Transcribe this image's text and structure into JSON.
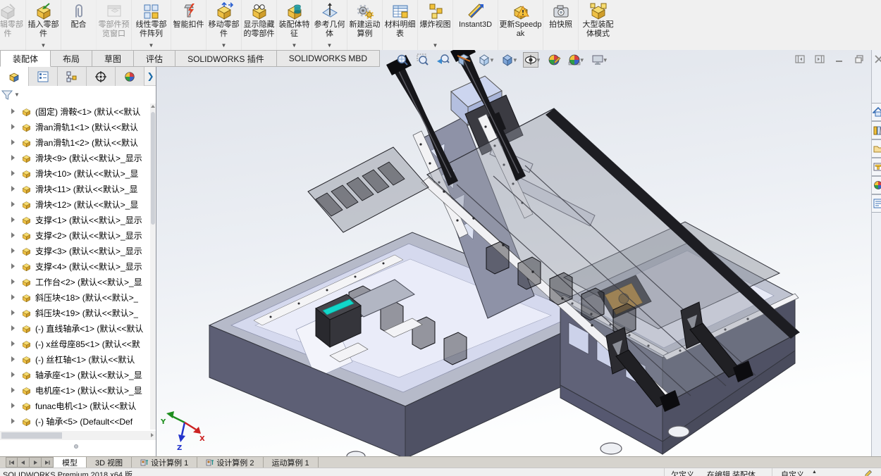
{
  "command_manager": {
    "buttons": [
      {
        "label": "编辑零部件",
        "icon": "edit-component-icon",
        "disabled": true,
        "dropdown": false
      },
      {
        "label": "插入零部件",
        "icon": "insert-component-icon",
        "dropdown": true
      },
      {
        "label": "配合",
        "icon": "mate-icon",
        "dropdown": false
      },
      {
        "label": "零部件预览窗口",
        "icon": "component-preview-icon",
        "disabled": true,
        "dropdown": false
      },
      {
        "label": "线性零部件阵列",
        "icon": "linear-pattern-icon",
        "dropdown": true,
        "wide": "w56"
      },
      {
        "label": "智能扣件",
        "icon": "smart-fasteners-icon",
        "dropdown": false
      },
      {
        "label": "移动零部件",
        "icon": "move-component-icon",
        "dropdown": true
      },
      {
        "label": "显示隐藏的零部件",
        "icon": "show-hidden-components-icon",
        "dropdown": false
      },
      {
        "label": "装配体特征",
        "icon": "assembly-features-icon",
        "dropdown": true
      },
      {
        "label": "参考几何体",
        "icon": "reference-geometry-icon",
        "dropdown": true
      },
      {
        "label": "新建运动算例",
        "icon": "new-motion-study-icon",
        "dropdown": false
      },
      {
        "label": "材料明细表",
        "icon": "bom-icon",
        "dropdown": false
      },
      {
        "label": "爆炸视图",
        "icon": "exploded-view-icon",
        "dropdown": true
      },
      {
        "label": "Instant3D",
        "icon": "instant3d-icon",
        "dropdown": false,
        "wide": "w64"
      },
      {
        "label": "更新Speedpak",
        "icon": "update-speedpak-icon",
        "dropdown": false,
        "wide": "w64"
      },
      {
        "label": "拍快照",
        "icon": "snapshot-icon",
        "dropdown": false
      },
      {
        "label": "大型装配体模式",
        "icon": "large-assembly-mode-icon",
        "dropdown": false,
        "wide": "w56"
      }
    ],
    "tabs": [
      {
        "label": "装配体",
        "active": true
      },
      {
        "label": "布局",
        "active": false
      },
      {
        "label": "草图",
        "active": false
      },
      {
        "label": "评估",
        "active": false
      },
      {
        "label": "SOLIDWORKS 插件",
        "active": false
      },
      {
        "label": "SOLIDWORKS MBD",
        "active": false
      }
    ]
  },
  "feature_panel": {
    "tabs": [
      {
        "icon": "featuremanager-tree-icon",
        "active": true
      },
      {
        "icon": "propertymanager-icon",
        "active": false
      },
      {
        "icon": "configurationmanager-icon",
        "active": false
      },
      {
        "icon": "dimxpertmanager-icon",
        "active": false
      },
      {
        "icon": "displaymanager-icon",
        "active": false
      }
    ],
    "expand_label": "❯",
    "filter": {
      "icon": "filter-funnel-icon"
    },
    "tree": [
      {
        "icon": "part-icon",
        "label": "(固定) 滑鞍<1> (默认<<默认"
      },
      {
        "icon": "part-icon",
        "label": "滑an滑轨1<1> (默认<<默认"
      },
      {
        "icon": "part-icon",
        "label": "滑an滑轨1<2> (默认<<默认"
      },
      {
        "icon": "part-icon",
        "label": "滑块<9> (默认<<默认>_显示"
      },
      {
        "icon": "part-icon",
        "label": "滑块<10> (默认<<默认>_显"
      },
      {
        "icon": "part-icon",
        "label": "滑块<11> (默认<<默认>_显"
      },
      {
        "icon": "part-icon",
        "label": "滑块<12> (默认<<默认>_显"
      },
      {
        "icon": "part-icon",
        "label": "支撑<1> (默认<<默认>_显示"
      },
      {
        "icon": "part-icon",
        "label": "支撑<2> (默认<<默认>_显示"
      },
      {
        "icon": "part-icon",
        "label": "支撑<3> (默认<<默认>_显示"
      },
      {
        "icon": "part-icon",
        "label": "支撑<4> (默认<<默认>_显示"
      },
      {
        "icon": "part-icon",
        "label": "工作台<2> (默认<<默认>_显"
      },
      {
        "icon": "part-icon",
        "label": "斜压块<18> (默认<<默认>_"
      },
      {
        "icon": "part-icon",
        "label": "斜压块<19> (默认<<默认>_"
      },
      {
        "icon": "part-icon",
        "label": "(-) 直线轴承<1> (默认<<默认"
      },
      {
        "icon": "part-icon",
        "label": "(-) x丝母座85<1> (默认<<默"
      },
      {
        "icon": "part-icon",
        "label": "(-) 丝杠轴<1> (默认<<默认"
      },
      {
        "icon": "part-icon",
        "label": "轴承座<1> (默认<<默认>_显"
      },
      {
        "icon": "part-icon",
        "label": "电机座<1> (默认<<默认>_显"
      },
      {
        "icon": "part-icon",
        "label": "funac电机<1> (默认<<默认"
      },
      {
        "icon": "part-icon",
        "label": "(-) 轴承<5> (Default<<Def"
      }
    ]
  },
  "viewport": {
    "heads_up": [
      {
        "icon": "zoom-fit-icon",
        "dropdown": false,
        "pressed": false
      },
      {
        "icon": "zoom-area-icon",
        "dropdown": false,
        "pressed": false
      },
      {
        "icon": "previous-view-icon",
        "dropdown": false,
        "pressed": false
      },
      {
        "icon": "section-view-icon",
        "dropdown": false,
        "pressed": false
      },
      {
        "icon": "view-orientation-icon",
        "dropdown": true,
        "pressed": false
      },
      {
        "icon": "display-style-icon",
        "dropdown": true,
        "pressed": false
      },
      {
        "icon": "hide-show-items-icon",
        "dropdown": true,
        "pressed": true
      },
      {
        "icon": "edit-appearance-icon",
        "dropdown": false,
        "pressed": false
      },
      {
        "icon": "apply-scene-icon",
        "dropdown": true,
        "pressed": false
      },
      {
        "icon": "view-settings-icon",
        "dropdown": true,
        "pressed": false
      }
    ],
    "triad": {
      "x_label": "X",
      "y_label": "Y",
      "z_label": "Z"
    }
  },
  "window": {
    "doc_controls": [
      {
        "icon": "collapse-left-pane-icon"
      },
      {
        "icon": "collapse-right-pane-icon"
      },
      {
        "icon": "minimize-icon"
      },
      {
        "icon": "restore-icon"
      },
      {
        "icon": "close-icon"
      }
    ]
  },
  "task_pane": {
    "items": [
      {
        "icon": "solidworks-resources-icon"
      },
      {
        "icon": "design-library-icon"
      },
      {
        "icon": "file-explorer-icon"
      },
      {
        "icon": "view-palette-icon"
      },
      {
        "icon": "appearances-scenes-icon"
      },
      {
        "icon": "custom-properties-icon"
      }
    ]
  },
  "bottom_bar": {
    "nav": [
      {
        "icon": "first-tab-icon"
      },
      {
        "icon": "prev-tab-icon"
      },
      {
        "icon": "next-tab-icon"
      },
      {
        "icon": "last-tab-icon"
      }
    ],
    "tabs": [
      {
        "label": "模型",
        "active": true,
        "icon": null
      },
      {
        "label": "3D 视图",
        "active": false,
        "icon": null
      },
      {
        "label": "设计算例 1",
        "active": false,
        "icon": "design-study-icon"
      },
      {
        "label": "设计算例 2",
        "active": false,
        "icon": "design-study-icon"
      },
      {
        "label": "运动算例 1",
        "active": false,
        "icon": null
      }
    ]
  },
  "status_bar": {
    "left_text": "SOLIDWORKS Premium 2018 x64 版",
    "items": [
      {
        "label": "欠定义"
      },
      {
        "label": "在编辑 装配体"
      },
      {
        "label": "自定义",
        "dropdown": true
      }
    ],
    "edit_icon": "pencil-icon"
  },
  "colors": {
    "accent_gold": "#f2c23a",
    "machine_slate": "#5d5f75",
    "teal_display": "#12d7c9",
    "viewport_gradient_top": "#dfe3ea"
  }
}
